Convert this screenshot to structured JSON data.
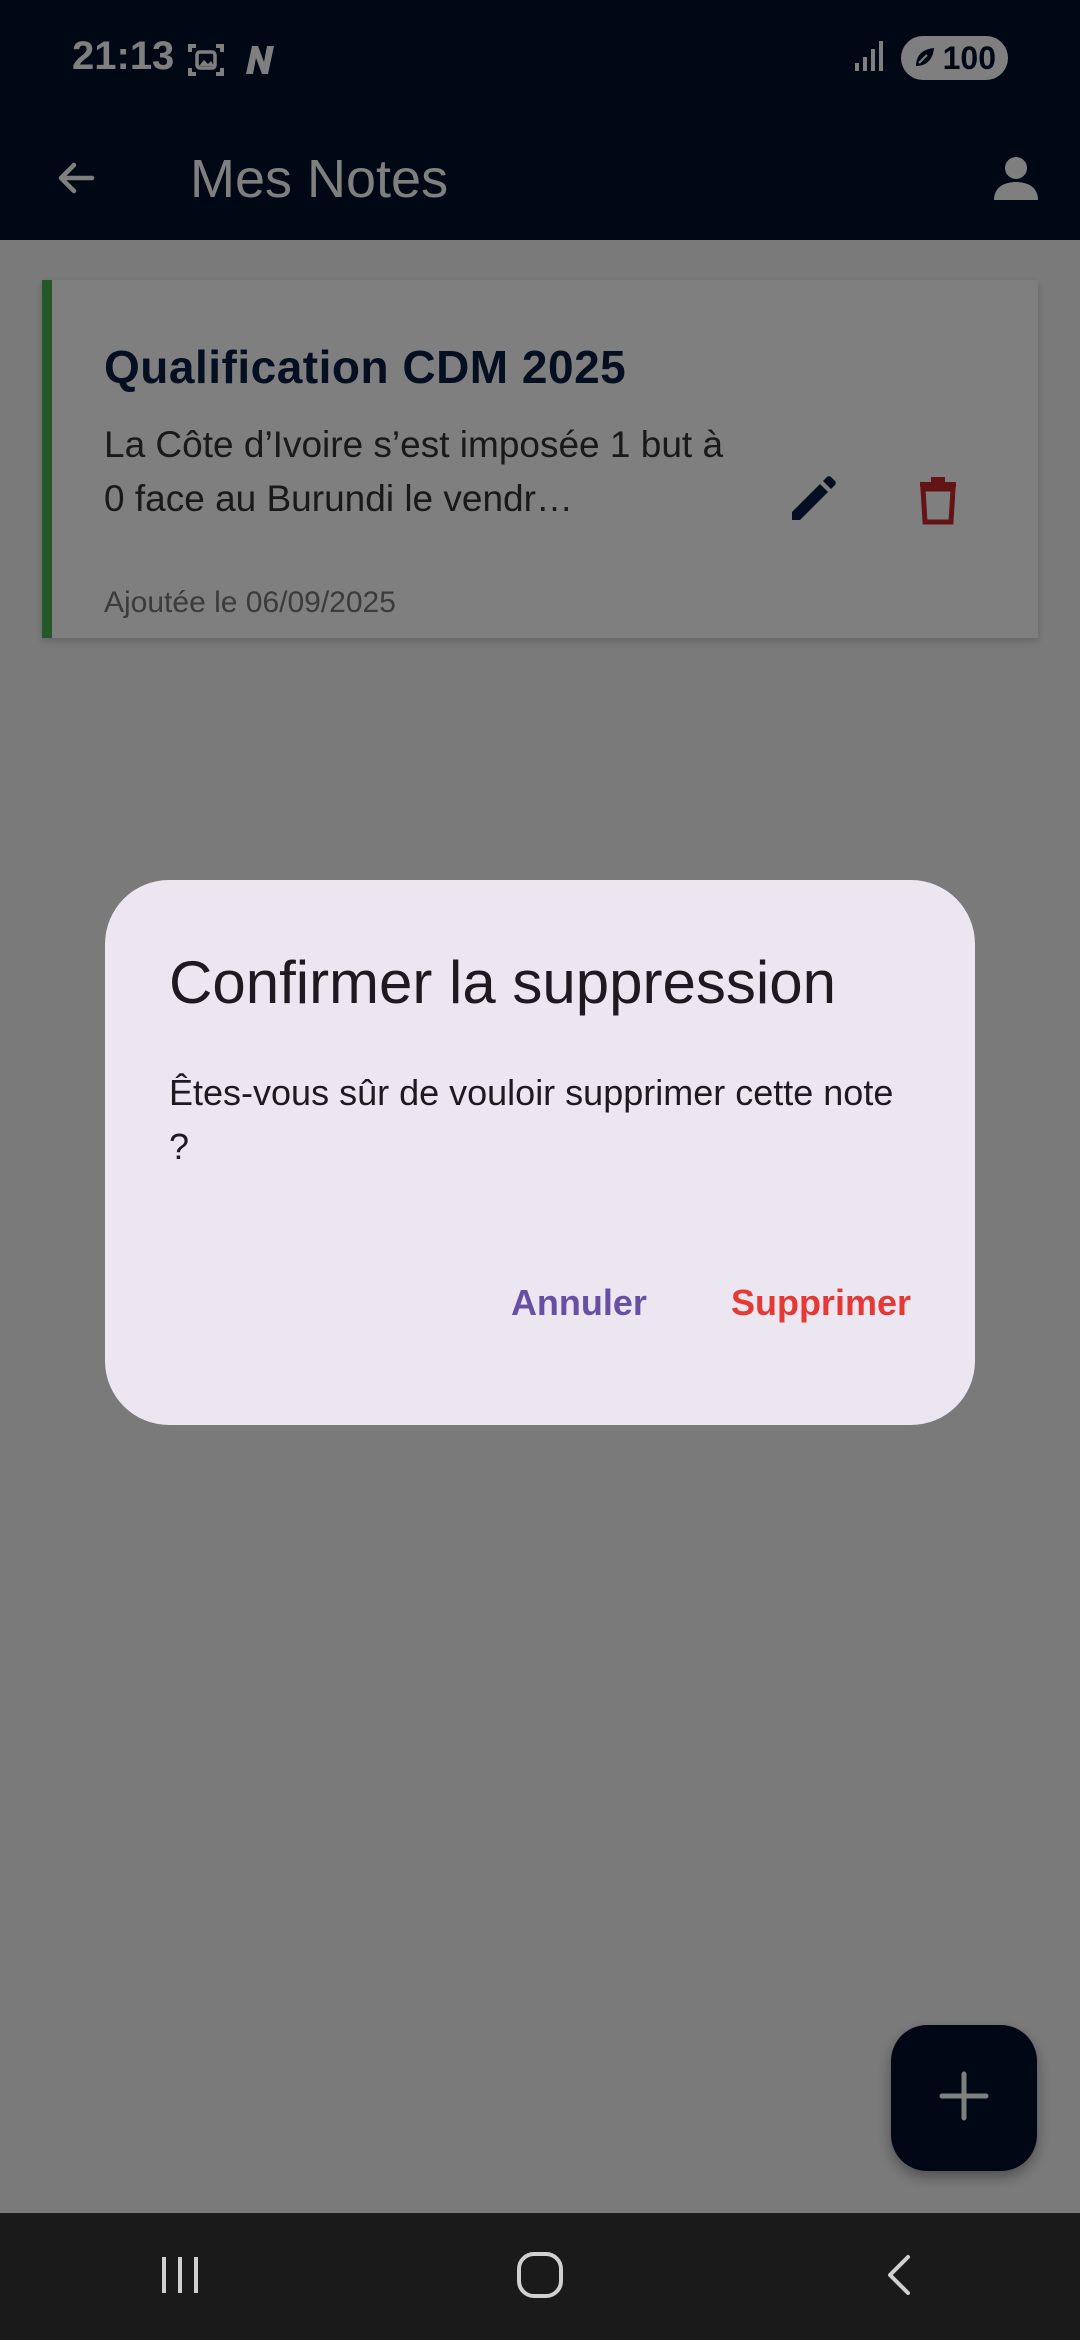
{
  "status_bar": {
    "time": "21:13",
    "battery": "100",
    "icons": [
      "screenshot-icon",
      "n-app-icon",
      "signal-icon",
      "battery-saver-icon"
    ]
  },
  "app_bar": {
    "title": "Mes Notes",
    "back_icon": "arrow-back-icon",
    "profile_icon": "person-icon"
  },
  "notes": [
    {
      "title": "Qualification CDM 2025",
      "excerpt": "La Côte d’Ivoire s’est imposée 1 but à 0 face au Burundi le vendr…",
      "date": "Ajoutée le 06/09/2025",
      "accent_color": "#4caf50"
    }
  ],
  "fab": {
    "icon": "plus-icon"
  },
  "dialog": {
    "title": "Confirmer la suppression",
    "message": "Êtes-vous sûr de vouloir supprimer cette note ?",
    "cancel_label": "Annuler",
    "confirm_label": "Supprimer"
  },
  "nav_bar": {
    "buttons": [
      "recents-icon",
      "home-icon",
      "back-icon"
    ]
  },
  "colors": {
    "primary": "#00112b",
    "dialog_bg": "#ece6f0",
    "cancel": "#6750a4",
    "danger": "#e53935",
    "edit_icon": "#0a1f44",
    "delete_icon": "#c62828"
  }
}
